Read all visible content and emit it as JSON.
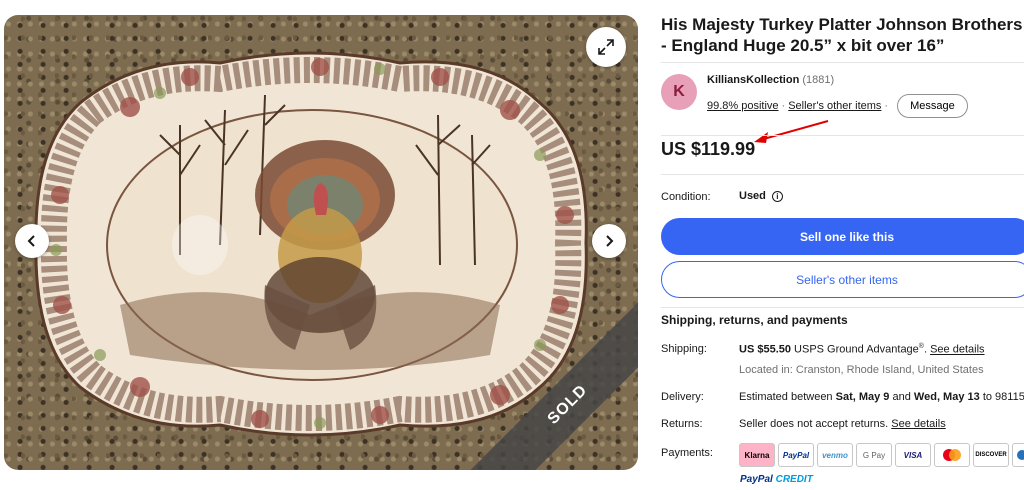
{
  "listing": {
    "title": "His Majesty Turkey Platter Johnson Brothers - England Huge 20.5” x bit over 16”",
    "price": "US $119.99",
    "sold_badge": "SOLD"
  },
  "seller": {
    "avatar_letter": "K",
    "name": "KilliansKollection",
    "feedback_count": "(1881)",
    "positive": "99.8% positive",
    "separator": "·",
    "other_items_link": "Seller's other items",
    "message_button": "Message"
  },
  "condition": {
    "label": "Condition:",
    "value": "Used"
  },
  "buttons": {
    "sell_one": "Sell one like this",
    "other_items": "Seller's other items"
  },
  "shipping_section": {
    "title": "Shipping, returns, and payments",
    "shipping_label": "Shipping:",
    "shipping_price": "US $55.50",
    "shipping_service": "USPS Ground Advantage",
    "shipping_reg": "®",
    "shipping_link": "See details",
    "location": "Located in: Cranston, Rhode Island, United States",
    "delivery_label": "Delivery:",
    "delivery_prefix": "Estimated between",
    "delivery_start": "Sat, May 9",
    "delivery_and": "and",
    "delivery_end": "Wed, May 13",
    "delivery_to": "to 98115",
    "returns_label": "Returns:",
    "returns_text": "Seller does not accept returns.",
    "returns_link": "See details",
    "payments_label": "Payments:"
  },
  "payments": {
    "methods": [
      "Klarna",
      "PayPal",
      "venmo",
      "G Pay",
      "VISA",
      "MC",
      "DISCOVER"
    ],
    "paypal_credit_a": "PayPal",
    "paypal_credit_b": "CREDIT"
  },
  "colors": {
    "primary_blue": "#3665f3",
    "text": "#191919",
    "muted": "#707070",
    "annotation_red": "#e00000"
  },
  "icons": {
    "expand": "expand-icon",
    "prev": "chevron-left-icon",
    "next": "chevron-right-icon",
    "info": "info-icon"
  }
}
